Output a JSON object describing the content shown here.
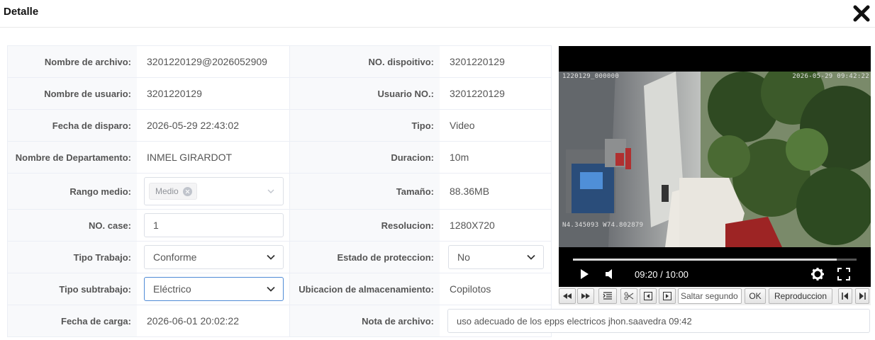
{
  "dialog": {
    "title": "Detalle"
  },
  "fields": {
    "nombre_archivo": {
      "label": "Nombre de archivo:",
      "value": "3201220129@2026052909"
    },
    "no_dispositivo": {
      "label": "NO. dispoitivo:",
      "value": "3201220129"
    },
    "nombre_usuario": {
      "label": "Nombre de usuario:",
      "value": "3201220129"
    },
    "usuario_no": {
      "label": "Usuario NO.:",
      "value": "3201220129"
    },
    "fecha_disparo": {
      "label": "Fecha de disparo:",
      "value": "2026-05-29 22:43:02"
    },
    "tipo": {
      "label": "Tipo:",
      "value": "Video"
    },
    "departamento": {
      "label": "Nombre de Departamento:",
      "value": "INMEL GIRARDOT"
    },
    "duracion": {
      "label": "Duracion:",
      "value": "10m"
    },
    "rango_medio": {
      "label": "Rango medio:",
      "tag": "Medio"
    },
    "tamano": {
      "label": "Tamaño:",
      "value": "88.36MB"
    },
    "no_case": {
      "label": "NO. case:",
      "value": "1"
    },
    "resolucion": {
      "label": "Resolucion:",
      "value": "1280X720"
    },
    "tipo_trabajo": {
      "label": "Tipo Trabajo:",
      "value": "Conforme"
    },
    "estado_proteccion": {
      "label": "Estado de proteccion:",
      "value": "No"
    },
    "tipo_subtrabajo": {
      "label": "Tipo subtrabajo:",
      "value": "Eléctrico"
    },
    "ubicacion": {
      "label": "Ubicacion de almacenamiento:",
      "value": "Copilotos"
    },
    "fecha_carga": {
      "label": "Fecha de carga:",
      "value": "2026-06-01 20:02:22"
    },
    "nota_archivo": {
      "label": "Nota de archivo:",
      "value": "uso adecuado de los epps electricos jhon.saavedra 09:42"
    }
  },
  "player": {
    "osd_top_left": "1220129_000000",
    "osd_top_right": "2026-05-29 09:42:22",
    "osd_bottom_left": "N4.345093 W74.802879",
    "time": "09:20 / 10:00",
    "progress": 0.93
  },
  "toolbar": {
    "seek_placeholder": "Saltar segundo",
    "ok_label": "OK",
    "playback_label": "Reproduccion"
  },
  "icons": {
    "close": "close-icon",
    "play": "play-icon",
    "volume": "volume-icon",
    "settings": "gear-icon",
    "fullscreen": "fullscreen-icon"
  },
  "colors": {
    "label_bg": "#f8f9fb",
    "border": "#ebeef5",
    "focus": "#4f8bd6",
    "player_bg": "#000000"
  }
}
